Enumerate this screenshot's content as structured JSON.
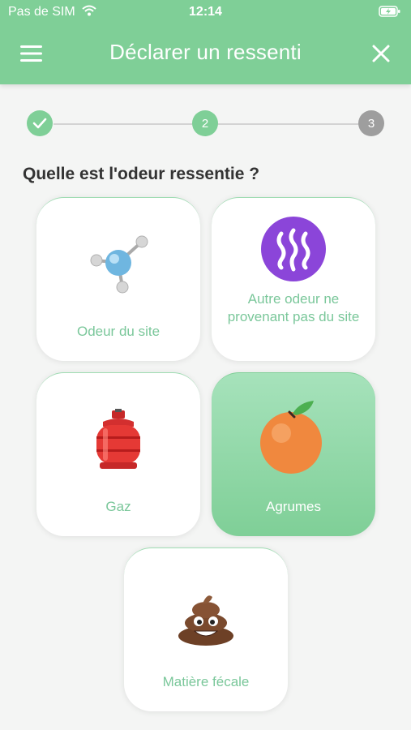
{
  "status_bar": {
    "carrier": "Pas de SIM",
    "time": "12:14"
  },
  "header": {
    "title": "Déclarer un ressenti",
    "menu_icon": "hamburger-menu-icon",
    "close_icon": "close-icon"
  },
  "stepper": {
    "steps": [
      {
        "label": "",
        "icon": "check-icon",
        "state": "done"
      },
      {
        "label": "2",
        "state": "current"
      },
      {
        "label": "3",
        "state": "upcoming"
      }
    ]
  },
  "question": "Quelle est l'odeur ressentie ?",
  "options": [
    {
      "label": "Odeur du site",
      "icon": "molecule-icon",
      "selected": false
    },
    {
      "label": "Autre odeur ne provenant pas du site",
      "icon": "heat-waves-icon",
      "selected": false
    },
    {
      "label": "Gaz",
      "icon": "gas-cylinder-icon",
      "selected": false
    },
    {
      "label": "Agrumes",
      "icon": "orange-icon",
      "selected": true
    },
    {
      "label": "Matière fécale",
      "icon": "poop-icon",
      "selected": false
    }
  ],
  "colors": {
    "primary": "#7fcf97",
    "label_green": "#7ac79a",
    "inactive_step": "#9e9e9e"
  }
}
